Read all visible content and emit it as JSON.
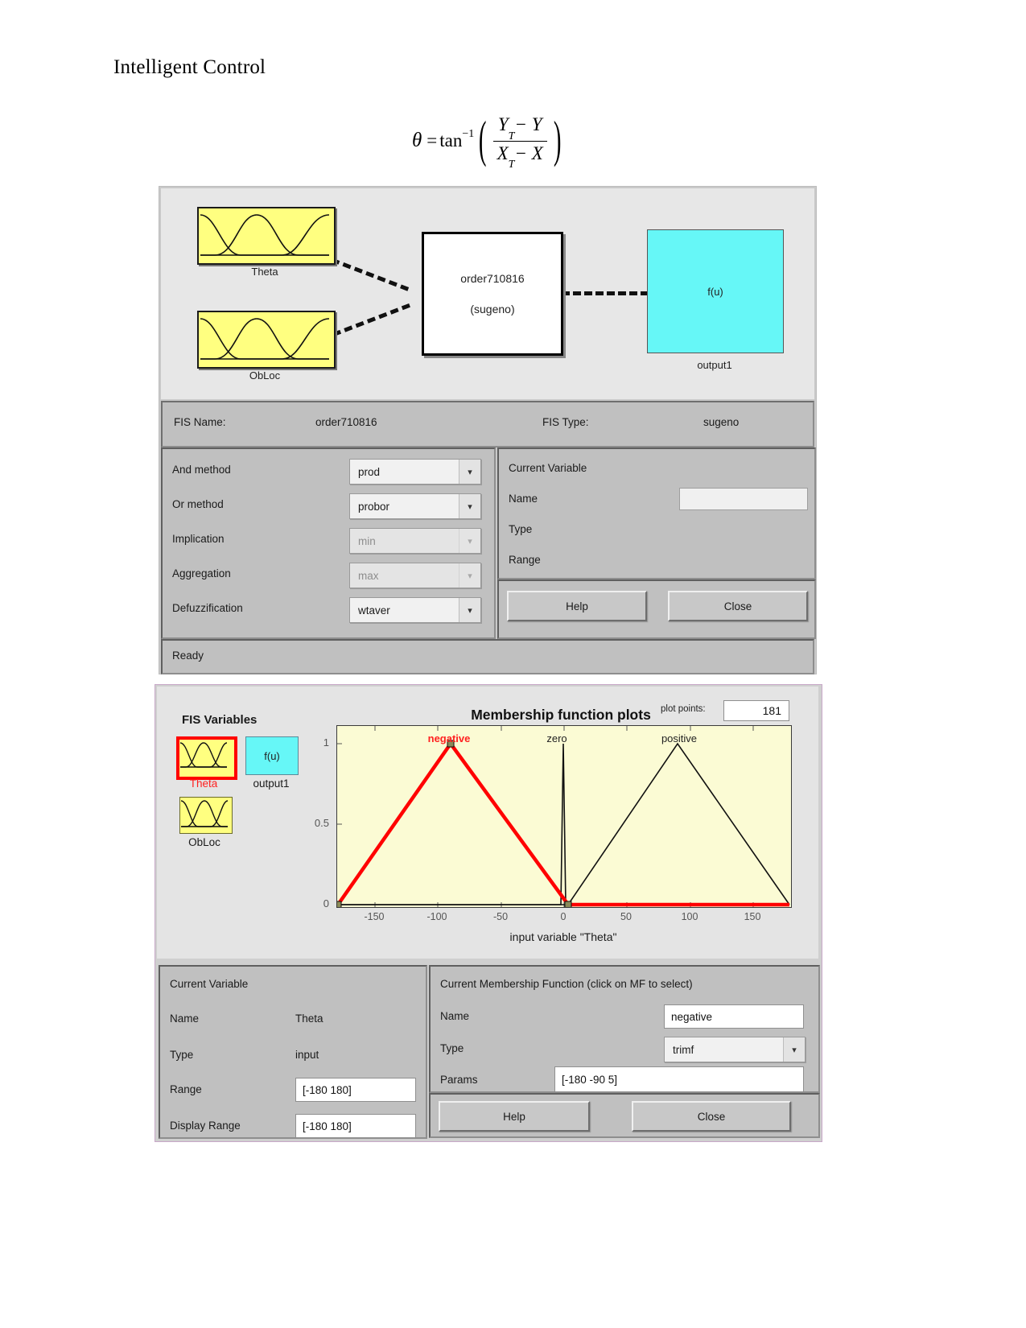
{
  "document": {
    "title": "Intelligent Control",
    "equation": {
      "theta": "θ",
      "equals": "=",
      "fn": "tan",
      "exponent": "−1",
      "numerator_main": "Y",
      "numerator_sub": "T",
      "numerator_minus": "− Y",
      "denominator_main": "X",
      "denominator_sub": "T",
      "denominator_minus": "− X"
    }
  },
  "fis_editor": {
    "diagram": {
      "input1_label": "Theta",
      "input2_label": "ObLoc",
      "rule_name": "order710816",
      "rule_type": "(sugeno)",
      "output_expr": "f(u)",
      "output_label": "output1"
    },
    "name_bar": {
      "fis_name_label": "FIS Name:",
      "fis_name_value": "order710816",
      "fis_type_label": "FIS Type:",
      "fis_type_value": "sugeno"
    },
    "methods": [
      {
        "label": "And method",
        "value": "prod",
        "disabled": false
      },
      {
        "label": "Or method",
        "value": "probor",
        "disabled": false
      },
      {
        "label": "Implication",
        "value": "min",
        "disabled": true
      },
      {
        "label": "Aggregation",
        "value": "max",
        "disabled": true
      },
      {
        "label": "Defuzzification",
        "value": "wtaver",
        "disabled": false
      }
    ],
    "current_variable": {
      "heading": "Current Variable",
      "name_label": "Name",
      "name_value": "",
      "type_label": "Type",
      "type_value": "",
      "range_label": "Range",
      "range_value": ""
    },
    "buttons": {
      "help": "Help",
      "close": "Close"
    },
    "status": "Ready"
  },
  "mf_editor": {
    "fis_variables_heading": "FIS Variables",
    "variables": [
      {
        "label": "Theta",
        "selected": true,
        "kind": "input"
      },
      {
        "label": "output1",
        "selected": false,
        "kind": "output",
        "glyph": "f(u)"
      },
      {
        "label": "ObLoc",
        "selected": false,
        "kind": "input"
      }
    ],
    "plot_title": "Membership function plots",
    "plot_points_label": "plot points:",
    "plot_points_value": "181",
    "current_variable": {
      "heading": "Current Variable",
      "name_label": "Name",
      "name_value": "Theta",
      "type_label": "Type",
      "type_value": "input",
      "range_label": "Range",
      "range_value": "[-180 180]",
      "display_range_label": "Display Range",
      "display_range_value": "[-180 180]"
    },
    "current_mf": {
      "heading": "Current Membership Function (click on MF to select)",
      "name_label": "Name",
      "name_value": "negative",
      "type_label": "Type",
      "type_value": "trimf",
      "params_label": "Params",
      "params_value": "[-180 -90 5]"
    },
    "buttons": {
      "help": "Help",
      "close": "Close"
    },
    "colors": {
      "selected_mf": "#ff0000",
      "plot_bg": "#fbfbd4",
      "input_thumb": "#ffff80",
      "output_thumb": "#66f7f7"
    }
  },
  "chart_data": {
    "type": "line",
    "title": "Membership function plots",
    "xlabel": "input variable \"Theta\"",
    "ylabel": "",
    "xlim": [
      -180,
      180
    ],
    "ylim": [
      0,
      1
    ],
    "xticks": [
      -150,
      -100,
      -50,
      0,
      50,
      100,
      150
    ],
    "xtick_labels": [
      "-150",
      "-100",
      "-50",
      "0",
      "50",
      "100",
      "150"
    ],
    "yticks": [
      0,
      0.5,
      1
    ],
    "ytick_labels": [
      "0",
      "0.5",
      "1"
    ],
    "grid": false,
    "legend": "inline-annotations",
    "series": [
      {
        "name": "negative",
        "color": "#ff0000",
        "selected": true,
        "type": "trimf",
        "params": [
          -180,
          -90,
          5
        ],
        "x": [
          -180,
          -90,
          5,
          180
        ],
        "y": [
          0,
          1,
          0,
          0
        ]
      },
      {
        "name": "zero",
        "color": "#000000",
        "selected": false,
        "type": "trimf",
        "params": [
          -2,
          0,
          2
        ],
        "x": [
          -180,
          -2,
          0,
          2,
          180
        ],
        "y": [
          0,
          0,
          1,
          0,
          0
        ]
      },
      {
        "name": "positive",
        "color": "#000000",
        "selected": false,
        "type": "trimf",
        "params": [
          5,
          90,
          180
        ],
        "x": [
          -180,
          5,
          90,
          180
        ],
        "y": [
          0,
          0,
          1,
          0
        ]
      }
    ]
  }
}
